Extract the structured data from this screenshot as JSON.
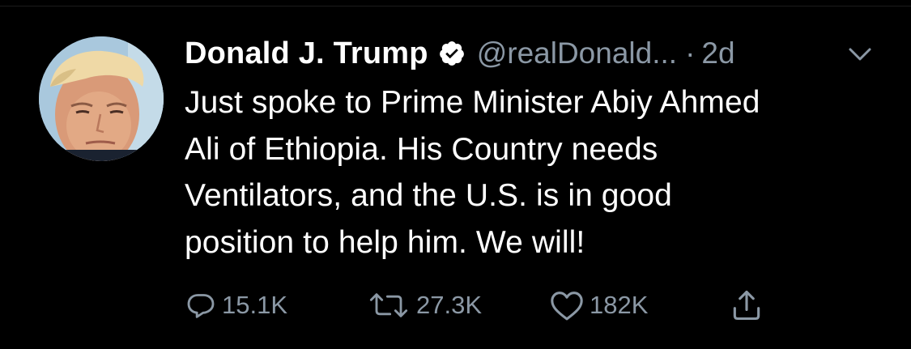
{
  "tweet": {
    "author": {
      "display_name": "Donald J. Trump",
      "handle": "@realDonald...",
      "verified": true
    },
    "separator": "·",
    "time": "2d",
    "text_lines": [
      "Just spoke to Prime Minister Abiy Ahmed",
      "Ali of Ethiopia. His Country needs",
      "Ventilators, and the U.S. is in good",
      "position to help him. We will!"
    ],
    "actions": {
      "reply_count": "15.1K",
      "retweet_count": "27.3K",
      "like_count": "182K"
    }
  },
  "colors": {
    "background": "#000000",
    "text_primary": "#ffffff",
    "text_secondary": "#8b98a5"
  },
  "icons": {
    "verified": "verified-badge-icon",
    "caret": "chevron-down-icon",
    "reply": "reply-icon",
    "retweet": "retweet-icon",
    "like": "heart-icon",
    "share": "share-icon"
  }
}
